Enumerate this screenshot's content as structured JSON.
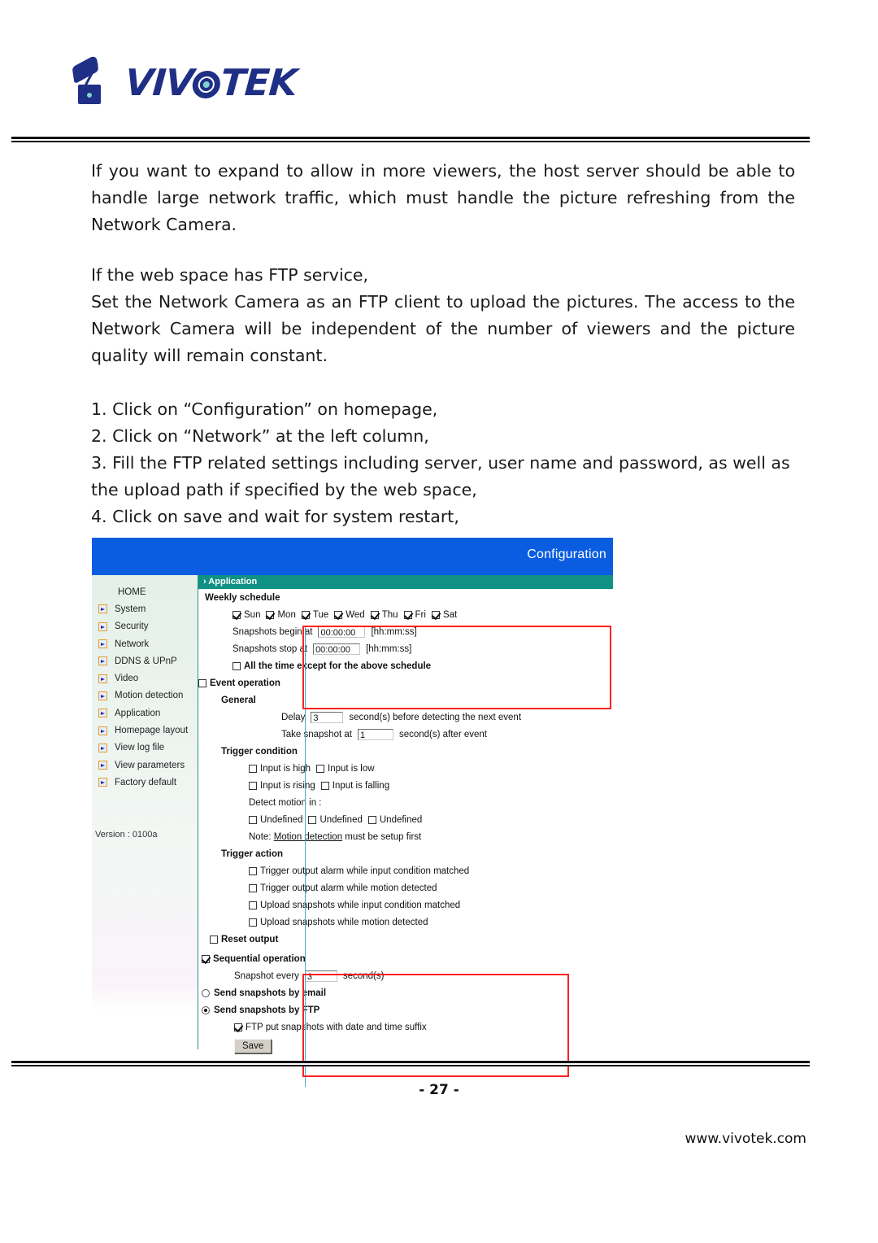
{
  "brand": {
    "logo_text": "VIVOTEK",
    "logo_icon": "vivotek-camera-logo"
  },
  "body": {
    "paragraph_1": "If you want to expand to allow in more viewers, the host server should be able to handle large network traffic, which must handle the picture refreshing from the Network Camera.",
    "paragraph_2_line1": "If the web space has FTP service,",
    "paragraph_2_line2": "Set the Network Camera as an FTP client to upload the pictures. The access to the Network Camera will be independent of the number of viewers and the picture quality will remain constant.",
    "steps": [
      "1. Click on “Configuration” on homepage,",
      "2. Click on “Network” at the left column,",
      "3. Fill the FTP related settings including server, user name and password, as well as the upload path if specified by the web space,",
      "4. Click on save and wait for system restart,"
    ]
  },
  "screenshot": {
    "header_title": "Configuration",
    "breadcrumb": "› Application",
    "version": "Version : 0100a",
    "sidebar": {
      "items": [
        {
          "label": "HOME",
          "has_icon": false
        },
        {
          "label": "System",
          "has_icon": true
        },
        {
          "label": "Security",
          "has_icon": true
        },
        {
          "label": "Network",
          "has_icon": true
        },
        {
          "label": "DDNS & UPnP",
          "has_icon": true
        },
        {
          "label": "Video",
          "has_icon": true
        },
        {
          "label": "Motion detection",
          "has_icon": true
        },
        {
          "label": "Application",
          "has_icon": true
        },
        {
          "label": "Homepage layout",
          "has_icon": true
        },
        {
          "label": "View log file",
          "has_icon": true
        },
        {
          "label": "View parameters",
          "has_icon": true
        },
        {
          "label": "Factory default",
          "has_icon": true
        }
      ]
    },
    "weekly_schedule": {
      "heading": "Weekly schedule",
      "days": [
        {
          "label": "Sun",
          "checked": true
        },
        {
          "label": "Mon",
          "checked": true
        },
        {
          "label": "Tue",
          "checked": true
        },
        {
          "label": "Wed",
          "checked": true
        },
        {
          "label": "Thu",
          "checked": true
        },
        {
          "label": "Fri",
          "checked": true
        },
        {
          "label": "Sat",
          "checked": true
        }
      ],
      "begin_label": "Snapshots begin at",
      "begin_value": "00:00:00",
      "begin_hint": "[hh:mm:ss]",
      "stop_label": "Snapshots stop at",
      "stop_value": "00:00:00",
      "stop_hint": "[hh:mm:ss]",
      "all_time_label": "All the time except for the above schedule",
      "all_time_checked": false
    },
    "event_operation": {
      "heading": "Event operation",
      "checked": false,
      "general_heading": "General",
      "delay_prefix": "Delay",
      "delay_value": "3",
      "delay_suffix": "second(s) before detecting the next event",
      "snapshot_prefix": "Take snapshot at",
      "snapshot_value": "1",
      "snapshot_suffix": "second(s) after event",
      "trigger_condition_heading": "Trigger condition",
      "conditions": [
        {
          "label": "Input is high",
          "checked": false
        },
        {
          "label": "Input is low",
          "checked": false
        },
        {
          "label": "Input is rising",
          "checked": false
        },
        {
          "label": "Input is falling",
          "checked": false
        }
      ],
      "detect_motion_label": "Detect motion in :",
      "motion_zones": [
        {
          "label": "Undefined",
          "checked": false
        },
        {
          "label": "Undefined",
          "checked": false
        },
        {
          "label": "Undefined",
          "checked": false
        }
      ],
      "note_prefix": "Note:",
      "note_link": "Motion detection",
      "note_suffix": "must be setup first",
      "trigger_action_heading": "Trigger action",
      "actions": [
        {
          "label": "Trigger output alarm while input condition matched",
          "checked": false
        },
        {
          "label": "Trigger output alarm while motion detected",
          "checked": false
        },
        {
          "label": "Upload snapshots while input condition matched",
          "checked": false
        },
        {
          "label": "Upload snapshots while motion detected",
          "checked": false
        }
      ],
      "reset_output_label": "Reset output",
      "reset_output_checked": false
    },
    "sequential_operation": {
      "heading": "Sequential operation",
      "checked": true,
      "every_prefix": "Snapshot every",
      "every_value": "3",
      "every_suffix": "second(s)",
      "send_email_label": "Send snapshots by email",
      "send_email_selected": false,
      "send_ftp_label": "Send snapshots by FTP",
      "send_ftp_selected": true,
      "ftp_suffix_label": "FTP put snapshots with date and time suffix",
      "ftp_suffix_checked": true,
      "save_label": "Save"
    },
    "colors": {
      "header_blue": "#0a5de0",
      "breadcrumb_teal": "#0f9184",
      "highlight_red": "#ff2020",
      "brand_navy": "#1f2f86",
      "brand_teal": "#7fd4cb"
    }
  },
  "footer": {
    "page_number": "- 27 -",
    "website": "www.vivotek.com"
  }
}
